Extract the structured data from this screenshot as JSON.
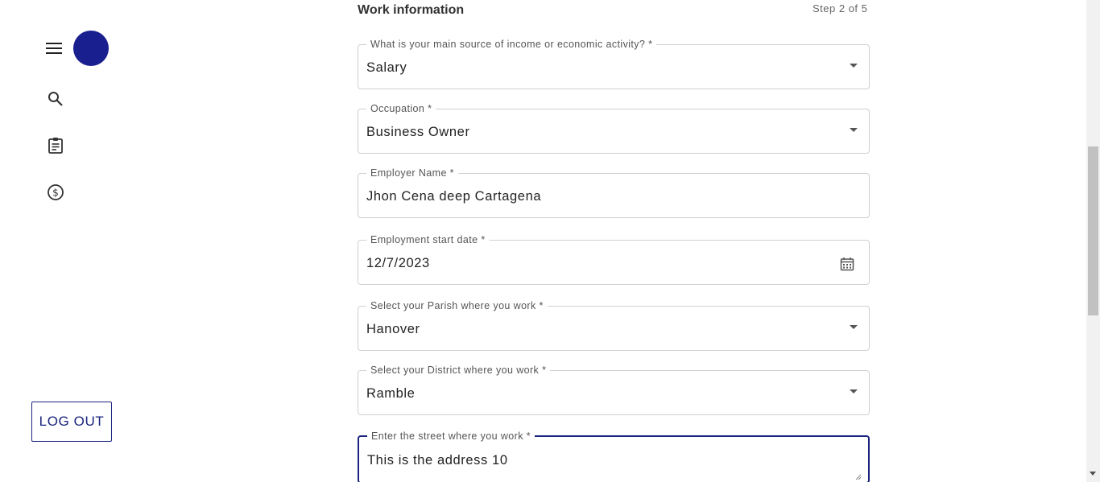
{
  "sidebar": {
    "icons": [
      "menu-icon",
      "search-icon",
      "clipboard-icon",
      "dollar-icon"
    ],
    "logout_label": "LOG OUT",
    "avatar_color": "#1a1f8f"
  },
  "form": {
    "section_title": "Work information",
    "step": "Step 2 of 5",
    "fields": [
      {
        "label": "What is your main source of income or economic activity? *",
        "value": "Salary"
      },
      {
        "label": "Occupation *",
        "value": "Business Owner"
      },
      {
        "label": "Employer Name *",
        "value": "Jhon Cena deep Cartagena"
      },
      {
        "label": "Employment start date *",
        "value": "12/7/2023"
      },
      {
        "label": "Select your Parish where you work *",
        "value": "Hanover"
      },
      {
        "label": "Select your District where you work *",
        "value": "Ramble"
      },
      {
        "label": "Enter the street where you work *",
        "value": "This is the address 10"
      }
    ]
  },
  "colors": {
    "accent": "#1a237e"
  }
}
